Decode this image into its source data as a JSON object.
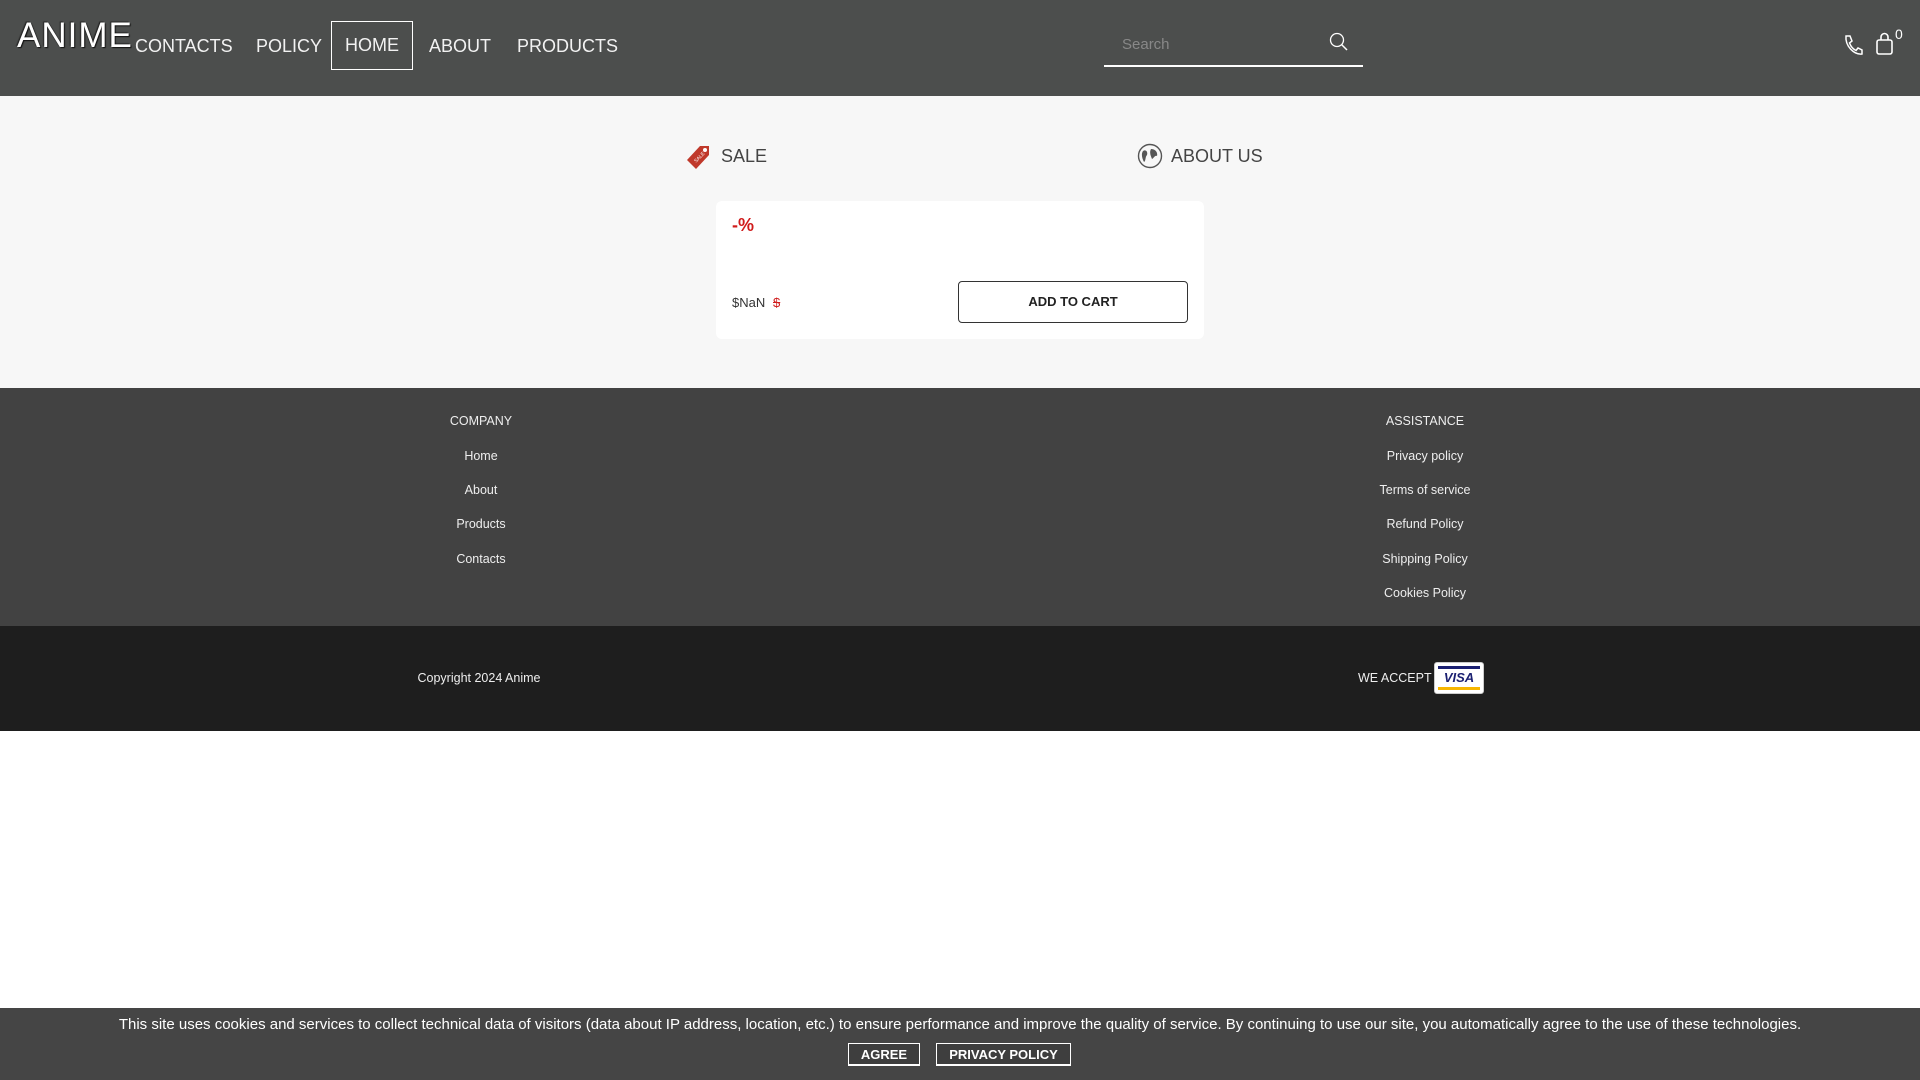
{
  "header": {
    "logo": "ANIME",
    "nav": [
      "CONTACTS",
      "POLICY",
      "HOME",
      "ABOUT",
      "PRODUCTS"
    ],
    "search_placeholder": "Search",
    "cart_count": "0"
  },
  "main": {
    "sale_label": "SALE",
    "about_label": "ABOUT US",
    "product": {
      "discount": "-%",
      "price": "$NaN",
      "old_price": "$",
      "add_to_cart": "ADD TO CART"
    }
  },
  "footer": {
    "company_title": "COMPANY",
    "company_links": [
      "Home",
      "About",
      "Products",
      "Contacts"
    ],
    "assistance_title": "ASSISTANCE",
    "assistance_links": [
      "Privacy policy",
      "Terms of service",
      "Refund Policy",
      "Shipping Policy",
      "Cookies Policy"
    ],
    "copyright": "Copyright 2024 Anime",
    "we_accept": "WE ACCEPT",
    "card_brand": "VISA"
  },
  "cookie": {
    "text": "This site uses cookies and services to collect technical data of visitors (data about IP address, location, etc.) to ensure performance and improve the quality of service. By continuing to use our site, you automatically agree to the use of these technologies.",
    "agree": "AGREE",
    "privacy": "PRIVACY POLICY"
  },
  "colors": {
    "header": "#4c4e4d",
    "sale_red": "#d01c1c",
    "footer": "#424242",
    "footer_bottom": "#1e1e1e"
  }
}
